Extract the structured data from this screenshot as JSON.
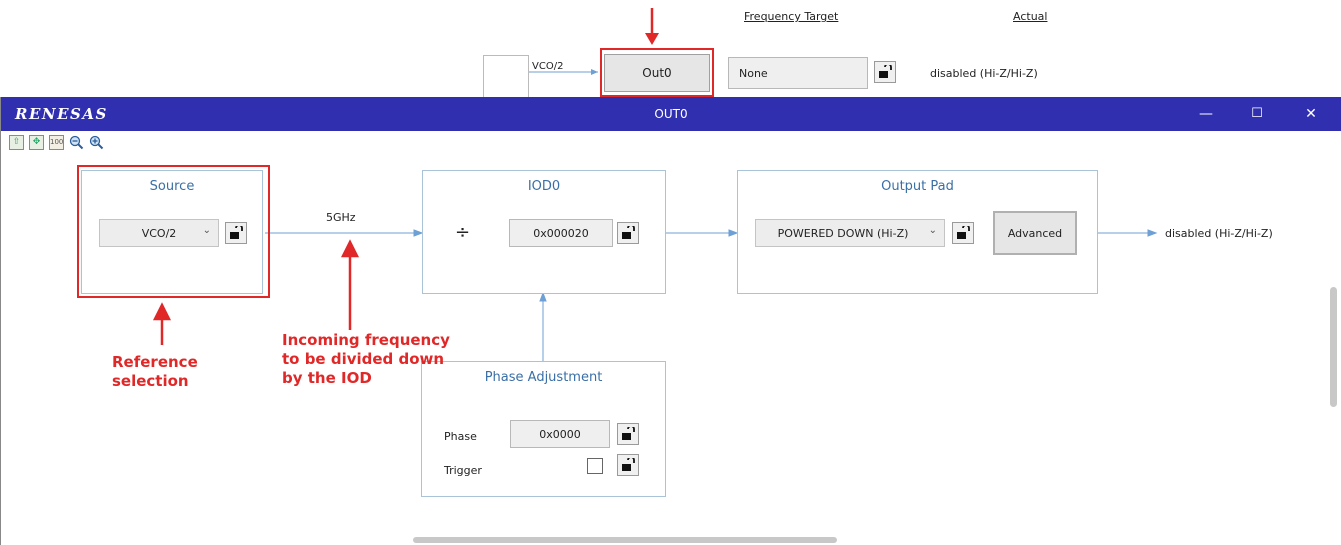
{
  "background": {
    "col_frequency_target": "Frequency Target",
    "col_actual": "Actual",
    "source_label": "VCO/2",
    "output_button": "Out0",
    "frequency_target_value": "None",
    "actual_value": "disabled (Hi-Z/Hi-Z)"
  },
  "window": {
    "brand": "RENESAS",
    "title": "OUT0",
    "minimize": "—",
    "maximize": "☐",
    "close": "✕"
  },
  "toolbar": {
    "icons": [
      "fit-icon",
      "expand-icon",
      "zoom-100-icon",
      "zoom-out-icon",
      "zoom-in-icon"
    ]
  },
  "source": {
    "title": "Source",
    "selected": "VCO/2",
    "frequency": "5GHz"
  },
  "iod": {
    "title": "IOD0",
    "divide_symbol": "÷",
    "value": "0x000020"
  },
  "output_pad": {
    "title": "Output Pad",
    "selected": "POWERED DOWN (Hi-Z)",
    "advanced_button": "Advanced",
    "result": "disabled (Hi-Z/Hi-Z)"
  },
  "phase": {
    "title": "Phase Adjustment",
    "phase_label": "Phase",
    "phase_value": "0x0000",
    "trigger_label": "Trigger"
  },
  "annotations": {
    "reference_line1": "Reference",
    "reference_line2": "selection",
    "incoming_line1": "Incoming frequency",
    "incoming_line2": "to be divided down",
    "incoming_line3": "by the IOD"
  },
  "colors": {
    "titlebar": "#2f2fb0",
    "panel_border": "#a9c3d9",
    "panel_title": "#3a6fa6",
    "annotation_red": "#e02828",
    "connector": "#6ea0d6"
  }
}
